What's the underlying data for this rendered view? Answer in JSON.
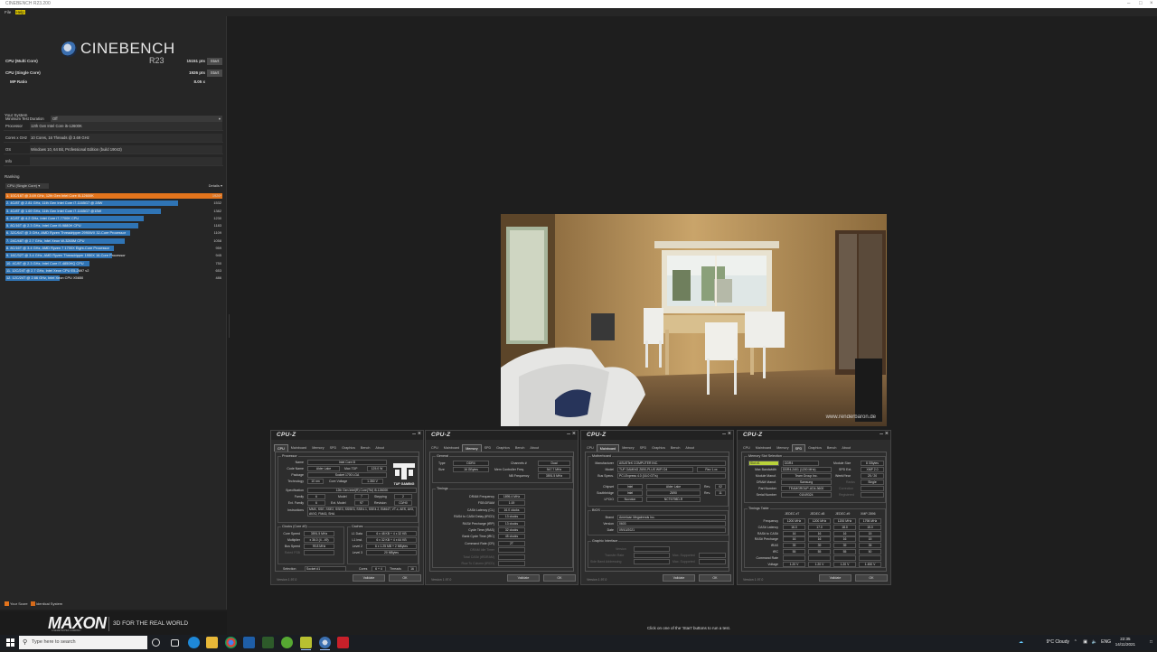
{
  "window": {
    "title": "CINEBENCH R23.200",
    "menu": [
      "File",
      "Help"
    ]
  },
  "logo": {
    "title": "CINEBENCH",
    "subtitle": "R23"
  },
  "scores": [
    {
      "label": "CPU (Multi Core)",
      "value": "15151 pts",
      "button": "Start"
    },
    {
      "label": "CPU (Single Core)",
      "value": "1926 pts",
      "button": "Start"
    },
    {
      "label": "MP Ratio",
      "value": "8.05 x"
    }
  ],
  "min_test": {
    "label": "Minimum Test Duration",
    "value": "Off"
  },
  "system": {
    "title": "Your System",
    "rows": [
      {
        "k": "Processor",
        "v": "12th Gen Intel Core i5-12600K"
      },
      {
        "k": "Cores x GHz",
        "v": "10 Cores, 16 Threads @ 3.69 GHz"
      },
      {
        "k": "OS",
        "v": "Windows 10, 64 Bit, Professional Edition (build 19043)"
      },
      {
        "k": "Info",
        "v": ""
      }
    ]
  },
  "ranking": {
    "title": "Ranking",
    "dropdown": "CPU (Single Core)",
    "details": "Details",
    "items": [
      {
        "label": "1. 10C/16T @ 3.69 GHz, 12th Gen Intel Core i5-12600K",
        "score": "1926*",
        "frac": 1.0,
        "mine": true
      },
      {
        "label": "2. 4C/8T @ 2.81 GHz, 11th Gen Intel Core i7-1165G7 @ 28W",
        "score": "1532",
        "frac": 0.795
      },
      {
        "label": "3. 4C/8T @ 1.69 GHz, 11th Gen Intel Core i7-1165G7 @15W",
        "score": "1382",
        "frac": 0.717
      },
      {
        "label": "4. 4C/8T @ 4.2 GHz, Intel Core i7-7700K CPU",
        "score": "1230",
        "frac": 0.638
      },
      {
        "label": "5. 8C/16T @ 2.3 GHz, Intel Core i9-9880H CPU",
        "score": "1183",
        "frac": 0.614
      },
      {
        "label": "6. 32C/64T @ 3 GHz, AMD Ryzen Threadripper 2990WX 32-Core Processor",
        "score": "1109",
        "frac": 0.576
      },
      {
        "label": "7. 24C/48T @ 2.7 GHz, Intel Xeon W-3265M CPU",
        "score": "1058",
        "frac": 0.549
      },
      {
        "label": "8. 8C/16T @ 3.4 GHz, AMD Ryzen 7 1700X Eight-Core Processor",
        "score": "959",
        "frac": 0.498
      },
      {
        "label": "9. 16C/32T @ 3.4 GHz, AMD Ryzen Threadripper 1950X 16-Core Processor",
        "score": "945",
        "frac": 0.49
      },
      {
        "label": "10. 4C/8T @ 2.3 GHz, Intel Core i7-4850HQ CPU",
        "score": "750",
        "frac": 0.389
      },
      {
        "label": "11. 12C/24T @ 2.7 GHz, Intel Xeon CPU E5-2697 v2",
        "score": "653",
        "frac": 0.339
      },
      {
        "label": "12. 12C/24T @ 2.66 GHz, Intel Xeon CPU X5650",
        "score": "486",
        "frac": 0.252
      }
    ]
  },
  "legend": {
    "your_score": "Your Score",
    "identical": "Identical System"
  },
  "footer": {
    "brand": "MAXON",
    "brand_sub": "A NEMETSCHEK COMPANY",
    "tagline": "3D FOR THE REAL WORLD",
    "hint": "Click on one of the 'Start' buttons to run a test."
  },
  "render": {
    "watermark": "www.renderbaron.de"
  },
  "cpuz": {
    "logo": "CPU-Z",
    "version": "Version 1.97.0",
    "validate": "Validate",
    "ok": "OK",
    "win1": {
      "tabs": [
        "CPU",
        "Mainboard",
        "Memory",
        "SPD",
        "Graphics",
        "Bench",
        "About"
      ],
      "processor": "Processor",
      "brand": "TUF GAMING",
      "name_l": "Name",
      "name": "Intel Core i5",
      "code_l": "Code Name",
      "code": "Alder Lake",
      "tdp_l": "Max TDP",
      "tdp": "125.0 W",
      "pkg_l": "Package",
      "pkg": "Socket 1700 LGA",
      "tech_l": "Technology",
      "tech": "10 nm",
      "cv_l": "Core Voltage",
      "cv": "1.350 V",
      "spec_l": "Specification",
      "spec": "12th Gen Intel(R) Core(TM) i5-12600K",
      "fam_l": "Family",
      "fam": "6",
      "model_l": "Model",
      "model": "7",
      "step_l": "Stepping",
      "step": "2",
      "efam_l": "Ext. Family",
      "efam": "6",
      "emodel_l": "Ext. Model",
      "emodel": "97",
      "rev_l": "Revision",
      "rev": "C0/H0",
      "inst_l": "Instructions",
      "inst": "MMX, SSE, SSE2, SSE3, SSSE3, SSE4.1, SSE4.2, EM64T, VT-x, AES, AVX, AVX2, FMA3, SHA",
      "clocks": "Clocks (Core #0)",
      "cache": "Caches",
      "cs_l": "Core Speed",
      "cs": "3591.5 MHz",
      "mul_l": "Multiplier",
      "mul": "x 36.0 (4 - 49)",
      "bs_l": "Bus Speed",
      "bs": "99.8 MHz",
      "fsb_l": "Rated FSB",
      "l1d_l": "L1 Data",
      "l1d": "6 x 48 KB + 4 x 32 KB",
      "l1i_l": "L1 Inst.",
      "l1i": "6 x 32 KB + 4 x 64 KB",
      "l2_l": "Level 2",
      "l2": "6 x 1.25 MB + 2 MBytes",
      "l3_l": "Level 3",
      "l3": "20 MBytes",
      "sel_l": "Selection",
      "sel": "Socket #1",
      "cores_l": "Cores",
      "cores": "6 + 4",
      "thr_l": "Threads",
      "thr": "16"
    },
    "win2": {
      "tabs": [
        "CPU",
        "Mainboard",
        "Memory",
        "SPD",
        "Graphics",
        "Bench",
        "About"
      ],
      "general": "General",
      "type_l": "Type",
      "type": "DDR4",
      "ch_l": "Channels #",
      "ch": "Dual",
      "size_l": "Size",
      "size": "16 GBytes",
      "mcf_l": "Mem Controller Freq.",
      "mcf": "947.7 MHz",
      "nb_l": "NB Frequency",
      "nb": "3591.5 MHz",
      "timings": "Timings",
      "rows": [
        {
          "l": "DRAM Frequency",
          "v": "1895.4 MHz"
        },
        {
          "l": "FSB:DRAM",
          "v": "1:19"
        },
        {
          "l": "CAS# Latency (CL)",
          "v": "16.0 clocks"
        },
        {
          "l": "RAS# to CAS# Delay (tRCD)",
          "v": "13 clocks"
        },
        {
          "l": "RAS# Precharge (tRP)",
          "v": "13 clocks"
        },
        {
          "l": "Cycle Time (tRAS)",
          "v": "32 clocks"
        },
        {
          "l": "Bank Cycle Time (tRC)",
          "v": "45 clocks"
        },
        {
          "l": "Command Rate (CR)",
          "v": "2T"
        },
        {
          "l": "DRAM Idle Timer",
          "v": "",
          "dim": true
        },
        {
          "l": "Total CAS# (tRDRAM)",
          "v": "",
          "dim": true
        },
        {
          "l": "Row To Column (tRCD)",
          "v": "",
          "dim": true
        }
      ]
    },
    "win3": {
      "tabs": [
        "CPU",
        "Mainboard",
        "Memory",
        "SPD",
        "Graphics",
        "Bench",
        "About"
      ],
      "mb": "Motherboard",
      "man_l": "Manufacturer",
      "man": "ASUSTeK COMPUTER INC.",
      "model_l": "Model",
      "model": "TUF GAMING Z690-PLUS WIFI D4",
      "rev_l": "Rev 1.xx",
      "bus_l": "Bus Specs.",
      "bus": "PCI-Express 4.0 (16.0 GT/s)",
      "chip_l": "Chipset",
      "chip": "Intel",
      "chip2": "Alder Lake",
      "chiprev_l": "Rev.",
      "chiprev": "02",
      "sb_l": "Southbridge",
      "sb": "Intel",
      "sb2": "Z690",
      "sbrev_l": "Rev.",
      "sbrev": "11",
      "lpc_l": "LPCIO",
      "lpc": "Nuvoton",
      "lpc2": "NCT6798D-R",
      "bios": "BIOS",
      "brand_l": "Brand",
      "brand": "American Megatrends Inc.",
      "ver_l": "Version",
      "ver": "0603",
      "date_l": "Date",
      "date": "09/10/2021",
      "gi": "Graphic Interface",
      "gi_ver_l": "Version",
      "gi_tr_l": "Transfer Rate",
      "gi_sb_l": "Side Band Addressing",
      "max_sup_l": "Max. Supported"
    },
    "win4": {
      "tabs": [
        "CPU",
        "Mainboard",
        "Memory",
        "SPD",
        "Graphics",
        "Bench",
        "About"
      ],
      "mss": "Memory Slot Selection",
      "slot": "Slot #1",
      "slot_type": "DDR4",
      "msize_l": "Module Size",
      "msize": "8 GBytes",
      "mbw_l": "Max Bandwidth",
      "mbw": "DDR4-2401 (1200 MHz)",
      "spd_l": "SPD Ext.",
      "spd": "XMP 2.0",
      "mm_l": "Module Manuf.",
      "mm": "Team Group Inc.",
      "wy_l": "Week/Year",
      "wy": "25 / 20",
      "dm_l": "DRAM Manuf.",
      "dm": "Samsung",
      "rk_l": "Ranks",
      "rk": "Single",
      "pn_l": "Part Number",
      "pn": "TEAMGROUP-UD4-3600",
      "corr_l": "Correction",
      "sn_l": "Serial Number",
      "sn": "01049324",
      "reg_l": "Registered",
      "tt": "Timings Table",
      "cols": [
        "JEDEC #7",
        "JEDEC #8",
        "JEDEC #9",
        "XMP-3596"
      ],
      "rows": [
        {
          "l": "Frequency",
          "v": [
            "1200 MHz",
            "1200 MHz",
            "1200 MHz",
            "1798 MHz"
          ]
        },
        {
          "l": "CAS# Latency",
          "v": [
            "16.0",
            "17.0",
            "18.0",
            "15.0"
          ]
        },
        {
          "l": "RAS# to CAS#",
          "v": [
            "16",
            "16",
            "16",
            "15"
          ]
        },
        {
          "l": "RAS# Precharge",
          "v": [
            "16",
            "16",
            "16",
            "15"
          ]
        },
        {
          "l": "tRAS",
          "v": [
            "39",
            "39",
            "39",
            "35"
          ]
        },
        {
          "l": "tRC",
          "v": [
            "55",
            "55",
            "55",
            "50"
          ]
        },
        {
          "l": "Command Rate",
          "v": [
            "",
            "",
            "",
            ""
          ]
        },
        {
          "l": "Voltage",
          "v": [
            "1.20 V",
            "1.20 V",
            "1.20 V",
            "1.450 V"
          ]
        }
      ]
    }
  },
  "taskbar": {
    "search": "Type here to search",
    "weather": "9°C Cloudy",
    "lang": "ENG",
    "time": "22:35",
    "date": "14/11/2021"
  },
  "colors": {
    "mine": "#e3741c",
    "others": "#2f74b5",
    "highlight": "#b9d23a"
  }
}
